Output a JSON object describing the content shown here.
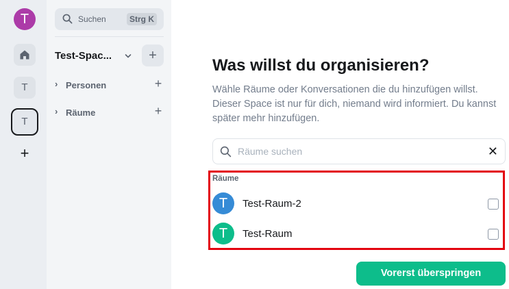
{
  "rail": {
    "user_avatar_letter": "T",
    "user_avatar_color": "#ac3ba8",
    "home_icon": "home-icon",
    "spaces": [
      {
        "letter": "T",
        "selected": false
      },
      {
        "letter": "T",
        "selected": true
      }
    ],
    "add_label": "+"
  },
  "room_list": {
    "search": {
      "placeholder": "Suchen",
      "shortcut": "Strg K"
    },
    "space_name": "Test-Spac...",
    "add_label": "+",
    "sections": [
      {
        "arrow": "›",
        "label": "Personen",
        "add_label": "+"
      },
      {
        "arrow": "›",
        "label": "Räume",
        "add_label": "+"
      }
    ]
  },
  "main": {
    "heading": "Was willst du organisieren?",
    "description": "Wähle Räume oder Konversationen die du hinzufügen willst. Dieser Space ist nur für dich, niemand wird informiert. Du kannst später mehr hinzufügen.",
    "filter": {
      "placeholder": "Räume suchen",
      "clear_label": "✕"
    },
    "group_label": "Räume",
    "rooms": [
      {
        "avatar_letter": "T",
        "avatar_color": "#368bd6",
        "name": "Test-Raum-2",
        "checked": false
      },
      {
        "avatar_letter": "T",
        "avatar_color": "#0dbd8b",
        "name": "Test-Raum",
        "checked": false
      }
    ],
    "skip_button": "Vorerst überspringen"
  },
  "colors": {
    "accent": "#0dbd8b",
    "highlight": "#e3000f"
  }
}
